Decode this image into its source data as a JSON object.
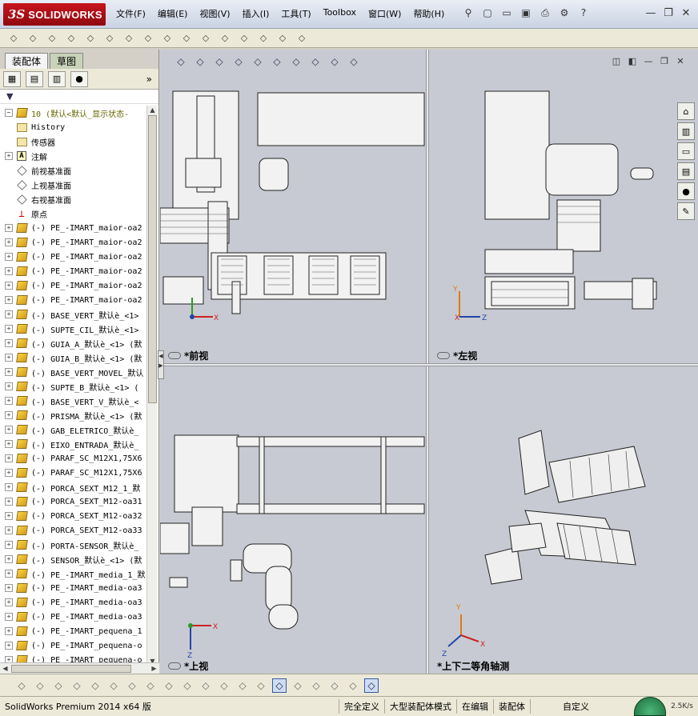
{
  "app": {
    "logo_ds": "3S",
    "logo_text": "SOLIDWORKS"
  },
  "menu": [
    "文件(F)",
    "编辑(E)",
    "视图(V)",
    "插入(I)",
    "工具(T)",
    "Toolbox",
    "窗口(W)",
    "帮助(H)"
  ],
  "quick_icons": [
    "pin-icon",
    "new-document-icon",
    "open-icon",
    "save-icon",
    "print-icon",
    "options-icon",
    "help-icon"
  ],
  "window_controls": [
    "minimize-icon",
    "restore-icon",
    "close-icon"
  ],
  "toolbar_icons": [
    "insert-component-icon",
    "mate-icon",
    "linear-pattern-icon",
    "smart-fasteners-icon",
    "move-component-icon",
    "show-hidden-icon",
    "assembly-features-icon",
    "reference-geometry-icon",
    "new-motion-study-icon",
    "bill-of-materials-icon",
    "exploded-view-icon",
    "explode-line-sketch-icon",
    "interference-detection-icon",
    "clearance-verification-icon",
    "hole-alignment-icon",
    "instant3d-icon"
  ],
  "left_panel": {
    "tabs": [
      "装配体",
      "草图"
    ],
    "manager_tabs": [
      "featuremanager-icon",
      "propertymanager-icon",
      "configurationmanager-icon",
      "displaymanager-icon"
    ],
    "more": "»",
    "filter": "▼",
    "tree": [
      {
        "label": "10  (默认<默认_显示状态-",
        "type": "root",
        "expand": "−"
      },
      {
        "label": "History",
        "type": "folder",
        "expand": ""
      },
      {
        "label": "传感器",
        "type": "folder",
        "expand": ""
      },
      {
        "label": "注解",
        "type": "annotation",
        "expand": "+"
      },
      {
        "label": "前视基准面",
        "type": "plane",
        "expand": ""
      },
      {
        "label": "上视基准面",
        "type": "plane",
        "expand": ""
      },
      {
        "label": "右视基准面",
        "type": "plane",
        "expand": ""
      },
      {
        "label": "原点",
        "type": "origin",
        "expand": ""
      },
      {
        "label": "(-) PE_-IMART_maior-oa2",
        "type": "part",
        "expand": "+"
      },
      {
        "label": "(-) PE_-IMART_maior-oa2",
        "type": "part",
        "expand": "+"
      },
      {
        "label": "(-) PE_-IMART_maior-oa2",
        "type": "part",
        "expand": "+"
      },
      {
        "label": "(-) PE_-IMART_maior-oa2",
        "type": "part",
        "expand": "+"
      },
      {
        "label": "(-) PE_-IMART_maior-oa2",
        "type": "part",
        "expand": "+"
      },
      {
        "label": "(-) PE_-IMART_maior-oa2",
        "type": "part",
        "expand": "+"
      },
      {
        "label": "(-) BASE_VERT_默认è_<1>",
        "type": "part",
        "expand": "+"
      },
      {
        "label": "(-) SUPTE_CIL_默认è_<1>",
        "type": "part",
        "expand": "+"
      },
      {
        "label": "(-) GUIA_A_默认è_<1> (默",
        "type": "part",
        "expand": "+"
      },
      {
        "label": "(-) GUIA_B_默认è_<1> (默",
        "type": "part",
        "expand": "+"
      },
      {
        "label": "(-) BASE_VERT_MOVEL_默认",
        "type": "part",
        "expand": "+"
      },
      {
        "label": "(-) SUPTE_B_默认è_<1> (",
        "type": "part",
        "expand": "+"
      },
      {
        "label": "(-) BASE_VERT_V_默认è_<",
        "type": "part",
        "expand": "+"
      },
      {
        "label": "(-) PRISMA_默认è_<1> (默",
        "type": "part",
        "expand": "+"
      },
      {
        "label": "(-) GAB_ELETRICO_默认è_",
        "type": "part",
        "expand": "+"
      },
      {
        "label": "(-) EIXO_ENTRADA_默认è_",
        "type": "part",
        "expand": "+"
      },
      {
        "label": "(-) PARAF_SC_M12X1,75X6",
        "type": "part",
        "expand": "+"
      },
      {
        "label": "(-) PARAF_SC_M12X1,75X6",
        "type": "part",
        "expand": "+"
      },
      {
        "label": "(-) PORCA_SEXT_M12_1_默",
        "type": "part",
        "expand": "+"
      },
      {
        "label": "(-) PORCA_SEXT_M12-oa31",
        "type": "part",
        "expand": "+"
      },
      {
        "label": "(-) PORCA_SEXT_M12-oa32",
        "type": "part",
        "expand": "+"
      },
      {
        "label": "(-) PORCA_SEXT_M12-oa33",
        "type": "part",
        "expand": "+"
      },
      {
        "label": "(-) PORTA-SENSOR_默认è_",
        "type": "part",
        "expand": "+"
      },
      {
        "label": "(-) SENSOR_默认è_<1> (默",
        "type": "part",
        "expand": "+"
      },
      {
        "label": "(-) PE_-IMART_media_1_默",
        "type": "part",
        "expand": "+"
      },
      {
        "label": "(-) PE_-IMART_media-oa3",
        "type": "part",
        "expand": "+"
      },
      {
        "label": "(-) PE_-IMART_media-oa3",
        "type": "part",
        "expand": "+"
      },
      {
        "label": "(-) PE_-IMART_media-oa3",
        "type": "part",
        "expand": "+"
      },
      {
        "label": "(-) PE_-IMART_pequena_1",
        "type": "part",
        "expand": "+"
      },
      {
        "label": "(-) PE_-IMART_pequena-o",
        "type": "part",
        "expand": "+"
      },
      {
        "label": "(-) PE_-IMART_pequena-o",
        "type": "part",
        "expand": "+"
      }
    ]
  },
  "viewport": {
    "headsup_icons": [
      "zoom-to-fit-icon",
      "zoom-to-area-icon",
      "previous-view-icon",
      "section-view-icon",
      "view-orientation-icon",
      "display-style-icon",
      "hide-show-items-icon",
      "edit-appearance-icon",
      "apply-scene-icon",
      "view-settings-icon"
    ],
    "viewport_controls": [
      "split-horizontal-icon",
      "split-vertical-icon",
      "minimize-icon",
      "restore-icon",
      "close-icon"
    ],
    "task_pane": [
      "home-icon",
      "design-library-icon",
      "file-explorer-icon",
      "view-palette-icon",
      "appearances-icon",
      "custom-properties-icon"
    ],
    "views": [
      {
        "caption": "*前视"
      },
      {
        "caption": "*左视"
      },
      {
        "caption": "*上视"
      },
      {
        "caption": "*上下二等角轴测"
      }
    ],
    "axis": {
      "x": "X",
      "y": "Y",
      "z": "Z"
    }
  },
  "sketch_icons": [
    "point-icon",
    "center-point-icon",
    "line-icon",
    "circle-icon",
    "trim-icon",
    "convert-icon",
    "offset-icon",
    "mirror-icon",
    "linear-pattern-icon",
    "move-icon",
    "smart-dimension-icon",
    "grid-icon",
    "relation-icon",
    "3d-sketch-icon",
    "shaded-icon",
    "display-icon",
    "split-icon",
    "appearance-icon",
    "single-view-icon",
    "four-view-icon"
  ],
  "status": {
    "left": "SolidWorks Premium 2014 x64 版",
    "fully_defined": "完全定义",
    "large_assembly": "大型装配体模式",
    "editing": "在编辑",
    "editing_target": "装配体",
    "custom": "自定义",
    "speed": "2.5K/s"
  }
}
